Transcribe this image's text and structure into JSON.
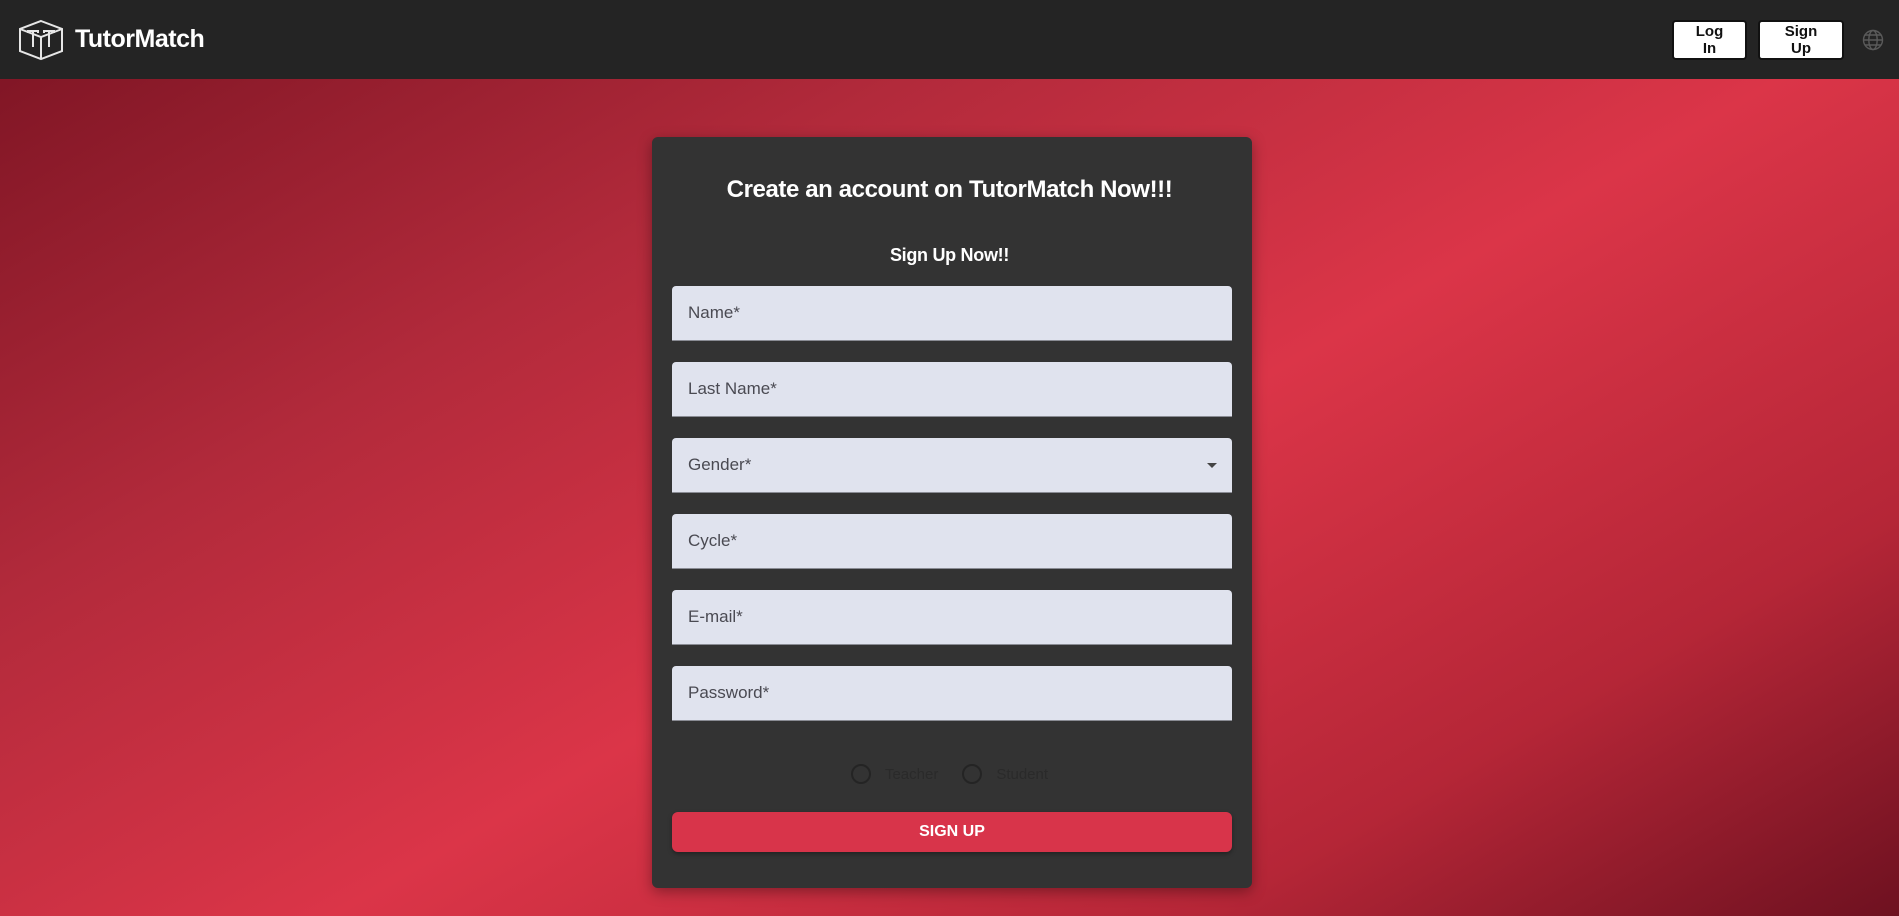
{
  "header": {
    "brand_name": "TutorMatch",
    "login_label": "Log In",
    "signup_label": "Sign Up",
    "logo_icon": "tutormatch-cube-logo",
    "language_icon": "globe-icon"
  },
  "form": {
    "title": "Create an account on TutorMatch Now!!!",
    "subtitle": "Sign Up Now!!",
    "fields": {
      "name": {
        "placeholder": "Name*",
        "value": ""
      },
      "last_name": {
        "placeholder": "Last Name*",
        "value": ""
      },
      "gender": {
        "label": "Gender*",
        "selected": ""
      },
      "cycle": {
        "placeholder": "Cycle*",
        "value": ""
      },
      "email": {
        "placeholder": "E-mail*",
        "value": ""
      },
      "password": {
        "placeholder": "Password*",
        "value": ""
      }
    },
    "roles": [
      {
        "label": "Teacher",
        "selected": false
      },
      {
        "label": "Student",
        "selected": false
      }
    ],
    "submit_label": "SIGN UP"
  },
  "colors": {
    "topbar": "#242424",
    "card": "#333333",
    "input_bg": "#e0e3ee",
    "accent": "#d8344a",
    "background_gradient": [
      "#7a1322",
      "#db3548",
      "#6e1120"
    ]
  }
}
